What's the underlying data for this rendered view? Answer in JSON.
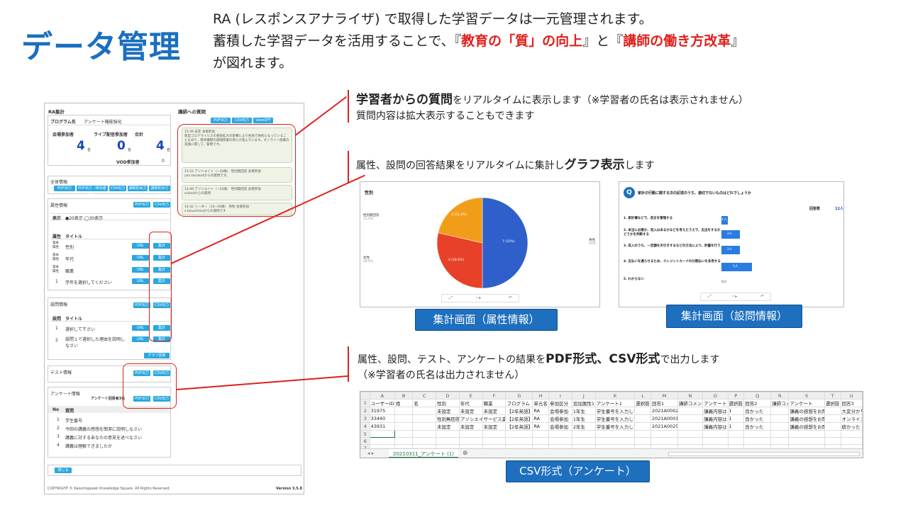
{
  "page": {
    "title": "データ管理",
    "intro_line1": "RA (レスポンスアナライザ) で取得した学習データは一元管理されます。",
    "intro_line2_a": "蓄積した学習データを活用することで、『",
    "intro_line2_red1": "教育の「質」の向上",
    "intro_line2_b": "』と『",
    "intro_line2_red2": "講師の働き方改革",
    "intro_line2_c": "』",
    "intro_line3": "が図れます。"
  },
  "ra": {
    "panel_title": "RA集計",
    "program_label": "プログラム名",
    "program_value": "アンケート機能強化",
    "col1": "会場参加者",
    "col2": "ライブ配信参加者",
    "col3": "合計",
    "val1": "4",
    "val2": "0",
    "val3": "4",
    "unit": "名",
    "vod_label": "VOD参加者",
    "vod_value": "0",
    "overall": "全体情報",
    "overall_buttons": [
      "PDF出力",
      "PDF出力（参加者別）",
      "CSV出力",
      "講師別出力",
      "講師別出力(CSV)"
    ],
    "attr": "属性情報",
    "pdf": "PDF出力",
    "csv": "CSV出力",
    "display_label": "表示",
    "display_value": "●20表示 ◯30表示",
    "attr_cols": [
      "属性",
      "タイトル"
    ],
    "attr_rows": [
      {
        "type": "基本属性",
        "title": "性別"
      },
      {
        "type": "基本属性",
        "title": "年代"
      },
      {
        "type": "基本属性",
        "title": "職業"
      },
      {
        "type": "1",
        "title": "学年を選択してください"
      }
    ],
    "btn_a": "URL",
    "btn_b": "集計",
    "q_info": "設問情報",
    "q_cols": [
      "設問",
      "タイトル"
    ],
    "q_rows": [
      {
        "no": "1",
        "title": "選択して下さい"
      },
      {
        "no": "2",
        "title": "設問１で選択した理由を説明しなさい"
      }
    ],
    "q_all_btn": "グラフ回答",
    "test_info": "テスト情報",
    "survey_info": "アンケート情報",
    "survey_count": "アンケート回答者3名",
    "survey_cols": [
      "No",
      "質問"
    ],
    "survey_rows": [
      {
        "no": "1",
        "text": "学生番号"
      },
      {
        "no": "2",
        "text": "今回の講義の感想を簡潔に説明しなさい"
      },
      {
        "no": "3",
        "text": "講義に対するあなたの意見を述べなさい"
      },
      {
        "no": "4",
        "text": "講義は理解できましたか"
      }
    ],
    "close_btn": "閉じる",
    "copyright": "COPYRIGHT © Kasumigaseki Knowledge Square. All Rights Reserved.",
    "version": "Version 3.5.8",
    "questions_title": "講師への質問",
    "questions_buttons": [
      "PDF出力",
      "CSV出力",
      "ViewOFF"
    ],
    "questions": [
      {
        "head": "15:39 未定 会場参加",
        "body": "新型コロナウイルスの感染拡大の影響により各地で休校になっていることもあり、教育機関の遠隔授業の導入が進んでいます。オンライン授業の実施に関して、質問です。"
      },
      {
        "head": "15:22 アソシエイト（~34歳） 性別無回答 会場参加",
        "body": "you.tanaka4からの質問です。"
      },
      {
        "head": "14:48 アソシエイト（~34歳） 性別無回答 会場参加",
        "body": "sslandからの質問"
      },
      {
        "head": "14:42 リーダー（35~39歳） 男性 会場参加",
        "body": "s.fukushimaからの質問です"
      }
    ]
  },
  "annotations": {
    "a1_bold": "学習者からの質問",
    "a1_rest": "をリアルタイムに表示します（※学習者の氏名は表示されません）",
    "a1_line2": "質問内容は拡大表示することもできます",
    "a2_a": "属性、設問の回答結果をリアルタイムに集計し",
    "a2_bold": "グラフ表示",
    "a2_b": "します",
    "a3_a": "属性、設問、テスト、アンケートの結果を",
    "a3_bold": "PDF形式、CSV形式",
    "a3_b": "で出力します",
    "a3_line2": "（※学習者の氏名は出力されません）"
  },
  "captions": {
    "pie": "集計画面（属性情報）",
    "bar": "集計画面（設問情報）",
    "csv": "CSV形式（アンケート）"
  },
  "pie_chart": {
    "title": "性別",
    "labels": [
      {
        "name": "性別無回答",
        "pct": "21.4%"
      },
      {
        "name": "女性",
        "pct": "28.6%"
      },
      {
        "name": "男性",
        "pct": "50%"
      }
    ],
    "inner": [
      "3 (21.4%)",
      "4 (28.6%)",
      "7 (50%)"
    ]
  },
  "bar_chart": {
    "question": "家計の行動に関する次の記述のうち、適切でないものはどれでしょうか",
    "badge": "Q",
    "count_label": "回答数",
    "count_value": "12人",
    "options": [
      {
        "no": "1.",
        "text": "家計簿などで、収支を管理する"
      },
      {
        "no": "2.",
        "text": "本当に必要か、収入はあるかなどを考えたうえで、支出をするかどうかを判断する"
      },
      {
        "no": "3.",
        "text": "収入のうち、一定額を天引きするなどの方法により、貯蓄を行う"
      },
      {
        "no": "4.",
        "text": "支払いを遅らせるため、クレジットカードの分割払いを多用する"
      },
      {
        "no": "5.",
        "text": "わからない"
      }
    ],
    "bar_labels": [
      "1人",
      "3人",
      "3人",
      "5人",
      "0人"
    ]
  },
  "chart_data": [
    {
      "type": "pie",
      "title": "性別",
      "categories": [
        "男性",
        "女性",
        "性別無回答"
      ],
      "values": [
        7,
        4,
        3
      ],
      "percents": [
        50,
        28.6,
        21.4
      ]
    },
    {
      "type": "bar",
      "title": "家計の行動に関する次の記述のうち、適切でないものはどれでしょうか",
      "categories": [
        "1",
        "2",
        "3",
        "4",
        "5"
      ],
      "values": [
        1,
        3,
        3,
        5,
        0
      ]
    }
  ],
  "sheet": {
    "col_letters": [
      "",
      "A",
      "B",
      "C",
      "D",
      "E",
      "F",
      "G",
      "H",
      "I",
      "J",
      "K",
      "L",
      "M",
      "N",
      "O",
      "P",
      "Q",
      "R",
      "S",
      "T",
      "U"
    ],
    "rows": [
      [
        "1",
        "ユーザーID",
        "姓",
        "名",
        "性別",
        "年代",
        "職業",
        "プログラム",
        "単元名",
        "参加区分",
        "追加属性1",
        "アンケート1",
        "選択肢",
        "回答1",
        "講師コメント",
        "アンケート",
        "選択肢",
        "回答2",
        "講師コメント",
        "アンケート",
        "選択肢",
        "回答3"
      ],
      [
        "2",
        "31975",
        "",
        "",
        "未設定",
        "未設定",
        "未設定",
        "【2年英語】",
        "RA",
        "会場参加",
        "1年生",
        "学生番号を入力してください",
        "",
        "2021A0002",
        "",
        "講義内容は",
        "1",
        "良かった",
        "",
        "講義の感想をお聞かせください",
        "",
        "大変分かり"
      ],
      [
        "3",
        "33440",
        "",
        "",
        "性別無回答",
        "アソシエイト",
        "サービス業",
        "【2年英語】",
        "RA",
        "会場参加",
        "1年生",
        "学生番号を入力してください",
        "",
        "2021A0001",
        "",
        "講義内容は",
        "1",
        "良かった",
        "",
        "講義の感想をお聞かせください",
        "",
        "オンライン"
      ],
      [
        "4",
        "43931",
        "",
        "",
        "未設定",
        "未設定",
        "未設定",
        "【2年英語】",
        "RA",
        "会場参加",
        "2年生",
        "学生番号を入力してください",
        "",
        "2021A0025",
        "",
        "講義内容は",
        "1",
        "良かった",
        "",
        "講義の感想をお聞かせください",
        "",
        "統かった"
      ],
      [
        "5",
        "",
        "",
        "",
        "",
        "",
        "",
        "",
        "",
        "",
        "",
        "",
        "",
        "",
        "",
        "",
        "",
        "",
        "",
        "",
        "",
        ""
      ],
      [
        "6",
        "",
        "",
        "",
        "",
        "",
        "",
        "",
        "",
        "",
        "",
        "",
        "",
        "",
        "",
        "",
        "",
        "",
        "",
        "",
        "",
        ""
      ],
      [
        "7",
        "",
        "",
        "",
        "",
        "",
        "",
        "",
        "",
        "",
        "",
        "",
        "",
        "",
        "",
        "",
        "",
        "",
        "",
        "",
        "",
        ""
      ]
    ],
    "tab_name": "20210311_アンケート (1)",
    "add_sheet": "⊕"
  }
}
